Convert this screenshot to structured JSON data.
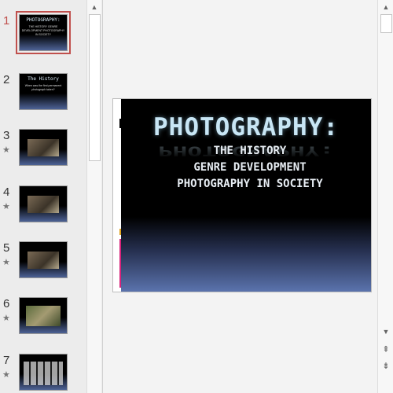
{
  "thumbnails": [
    {
      "number": "1",
      "title": "PHOTOGRAPHY:",
      "sub": "THE HISTORY GENRE DEVELOPMENT PHOTOGRAPHY IN SOCIETY",
      "selected": true,
      "animated": false,
      "kind": "title"
    },
    {
      "number": "2",
      "title": "The History",
      "sub": "When was the first permanent photograph taken?",
      "selected": false,
      "animated": false,
      "kind": "text"
    },
    {
      "number": "3",
      "title": "",
      "sub": "",
      "selected": false,
      "animated": true,
      "kind": "photo"
    },
    {
      "number": "4",
      "title": "",
      "sub": "",
      "selected": false,
      "animated": true,
      "kind": "photo"
    },
    {
      "number": "5",
      "title": "",
      "sub": "",
      "selected": false,
      "animated": true,
      "kind": "photo"
    },
    {
      "number": "6",
      "title": "",
      "sub": "",
      "selected": false,
      "animated": true,
      "kind": "green"
    },
    {
      "number": "7",
      "title": "",
      "sub": "",
      "selected": false,
      "animated": true,
      "kind": "grid"
    }
  ],
  "slide": {
    "title": "PHOTOGRAPHY:",
    "lines": [
      "THE HISTORY",
      "GENRE DEVELOPMENT",
      "PHOTOGRAPHY IN SOCIETY"
    ]
  },
  "icons": {
    "animation": "star-icon",
    "scroll_up": "scroll-up-icon",
    "scroll_down": "scroll-down-icon",
    "prev_slide": "previous-slide-icon",
    "next_slide": "next-slide-icon"
  },
  "colors": {
    "selection": "#c0504d",
    "title_text": "#c8e6f5",
    "gradient_bottom": "#5a73ad"
  }
}
